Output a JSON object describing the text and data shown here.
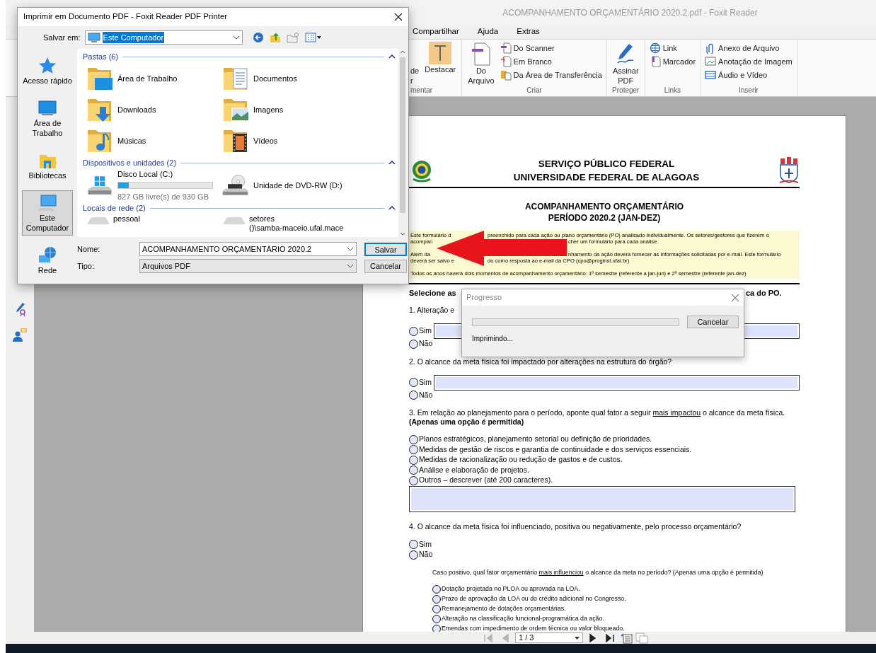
{
  "app": {
    "title": "ACOMPANHAMENTO ORÇAMENTÁRIO 2020.2.pdf - Foxit Reader"
  },
  "menu": [
    "Compartilhar",
    "Ajuda",
    "Extras"
  ],
  "ribbon": {
    "groups": [
      {
        "label": "mentar",
        "large": [
          {
            "kind": "fragment",
            "lines": [
              "de",
              "r"
            ]
          },
          {
            "kind": "button",
            "lines": [
              "Destacar"
            ]
          }
        ]
      },
      {
        "label": "Criar",
        "large": [
          {
            "kind": "button",
            "lines": [
              "Do",
              "Arquivo"
            ]
          }
        ],
        "small": [
          "Do Scanner",
          "Em Branco",
          "Da Área de Transferência"
        ]
      },
      {
        "label": "Proteger",
        "large": [
          {
            "kind": "button",
            "lines": [
              "Assinar",
              "PDF"
            ]
          }
        ]
      },
      {
        "label": "Links",
        "small": [
          "Link",
          "Marcador"
        ]
      },
      {
        "label": "Inserir",
        "small": [
          "Anexo de Arquivo",
          "Anotação de Imagem",
          "Áudio e Vídeo"
        ]
      }
    ]
  },
  "document": {
    "header": [
      "SERVIÇO PÚBLICO FEDERAL",
      "UNIVERSIDADE FEDERAL DE ALAGOAS"
    ],
    "title": [
      "ACOMPANHAMENTO ORÇAMENTÁRIO",
      "PERÍODO 2020.2 (JAN-DEZ)"
    ],
    "notice": [
      {
        "lines": [
          [
            "Este formulário d",
            "preenchido para cada ação ou plano orçamentário (PO) analisado individualmente. Os setores/gestores que fizerem o"
          ],
          [
            "acompan",
            "cher um formulário para cada análise."
          ]
        ]
      },
      {
        "lines": [
          [
            "Além da",
            "nhamento da ação deverá fornecer as informações solicitadas por e-mail. Este formulário"
          ],
          [
            "deverá ser salvo e",
            "do como resposta ao e-mail da CPO (cpo@proginst.ufal.br)"
          ]
        ]
      },
      {
        "lines": [
          [
            "Todos os anos haverá dois momentos de acompanhamento orçamentário: 1º semestre (referente a jan-jun) e 2º semestre (referente jan-dez)"
          ]
        ]
      }
    ],
    "blocks": [
      {
        "kind": "heading",
        "parts": [
          "Selecione as",
          "ca do PO."
        ]
      },
      {
        "kind": "question",
        "parts": [
          {
            "text": "1. Alteração e"
          }
        ]
      },
      {
        "kind": "radio",
        "label": "Sim",
        "checked": false,
        "field": true
      },
      {
        "kind": "radio",
        "label": "Não",
        "checked": false
      },
      {
        "kind": "question",
        "parts": [
          {
            "text": "2. O alcance da meta física foi impactado por alterações na estrutura do órgão?"
          }
        ]
      },
      {
        "kind": "radio",
        "label": "Sim",
        "checked": false,
        "field": true
      },
      {
        "kind": "radio",
        "label": "Não",
        "checked": false
      },
      {
        "kind": "question",
        "parts": [
          {
            "text": "3. Em relação ao planejamento para o período, aponte qual fator a seguir "
          },
          {
            "text": "mais impactou",
            "underline": true
          },
          {
            "text": " o alcance da meta física."
          }
        ]
      },
      {
        "kind": "emphasis",
        "text": "(Apenas uma opção é permitida)"
      },
      {
        "kind": "option",
        "label": "Planos estratégicos, planejamento setorial ou definição de prioridades.",
        "checked": false
      },
      {
        "kind": "option",
        "label": "Medidas de gestão de riscos e garantia de continuidade e dos serviços essenciais.",
        "checked": false
      },
      {
        "kind": "option",
        "label": "Medidas de racionalização ou redução de gastos e de custos.",
        "checked": false
      },
      {
        "kind": "option",
        "label": "Análise e elaboração de projetos.",
        "checked": false
      },
      {
        "kind": "option",
        "label": "Outros – descrever (até 200 caracteres).",
        "checked": false
      },
      {
        "kind": "textarea"
      },
      {
        "kind": "question",
        "parts": [
          {
            "text": "4. O alcance da meta física foi influenciado, positiva ou negativamente, pelo processo orçamentário?"
          }
        ]
      },
      {
        "kind": "radio",
        "label": "Sim",
        "checked": false
      },
      {
        "kind": "radio",
        "label": "Não",
        "checked": false
      },
      {
        "kind": "note",
        "parts": [
          {
            "text": "Caso positivo, qual fator orçamentário "
          },
          {
            "text": "mais influenciou",
            "underline": true
          },
          {
            "text": " o alcance da meta no período? (Apenas uma opção é permitida)"
          }
        ]
      },
      {
        "kind": "suboption",
        "label": "Dotação projetada no PLOA ou aprovada na LOA.",
        "checked": false
      },
      {
        "kind": "suboption",
        "label": "Prazo de aprovação da LOA ou do crédito adicional no Congresso.",
        "checked": false
      },
      {
        "kind": "suboption",
        "label": "Remanejamento de dotações orçamentárias.",
        "checked": false
      },
      {
        "kind": "suboption",
        "label": "Alteração na classificação funcional-programática da ação.",
        "checked": false
      },
      {
        "kind": "suboption",
        "label": "Emendas com impedimento de ordem técnica ou valor bloqueado.",
        "checked": false
      }
    ]
  },
  "page_nav": {
    "page": "1 / 3",
    "buttons": [
      {
        "disabled": true
      },
      {
        "disabled": true
      },
      {
        "disabled": false
      },
      {
        "disabled": false
      }
    ]
  },
  "save_dialog": {
    "title": "Imprimir em Documento PDF - Foxit Reader PDF Printer",
    "location_label": "Salvar em:",
    "location": "Este Computador",
    "places": [
      {
        "label": "Acesso rápido",
        "selected": false
      },
      {
        "label": "Área de Trabalho",
        "selected": false
      },
      {
        "label": "Bibliotecas",
        "selected": false
      },
      {
        "label": "Este Computador",
        "selected": true
      },
      {
        "label": "Rede",
        "selected": false
      }
    ],
    "sections": [
      {
        "title": "Pastas (6)",
        "expanded": true,
        "items": [
          {
            "label": "Área de Trabalho"
          },
          {
            "label": "Documentos"
          },
          {
            "label": "Downloads"
          },
          {
            "label": "Imagens"
          },
          {
            "label": "Músicas"
          },
          {
            "label": "Vídeos"
          }
        ]
      },
      {
        "title": "Dispositivos e unidades (2)",
        "expanded": true,
        "items": [
          {
            "label": "Disco Local (C:)",
            "kind": "drive",
            "level": 0.11,
            "detail": "827 GB livre(s) de 930 GB"
          },
          {
            "label": "Unidade de DVD-RW (D:)",
            "kind": "dvd"
          }
        ]
      },
      {
        "title": "Locais de rede (2)",
        "expanded": true,
        "items": [
          {
            "label": "pessoal",
            "kind": "network"
          },
          {
            "label": "setores",
            "kind": "network",
            "detail": "()\\samba-maceio.ufal.mace"
          }
        ]
      }
    ],
    "filename_label": "Nome:",
    "filename": "ACOMPANHAMENTO ORÇAMENTÁRIO 2020.2",
    "type_label": "Tipo:",
    "type": "Arquivos PDF",
    "buttons": [
      {
        "label": "Salvar",
        "default": true
      },
      {
        "label": "Cancelar",
        "default": false
      }
    ]
  },
  "progress_dialog": {
    "title": "Progresso",
    "level": 0,
    "button": "Cancelar",
    "status": "Imprimindo..."
  }
}
